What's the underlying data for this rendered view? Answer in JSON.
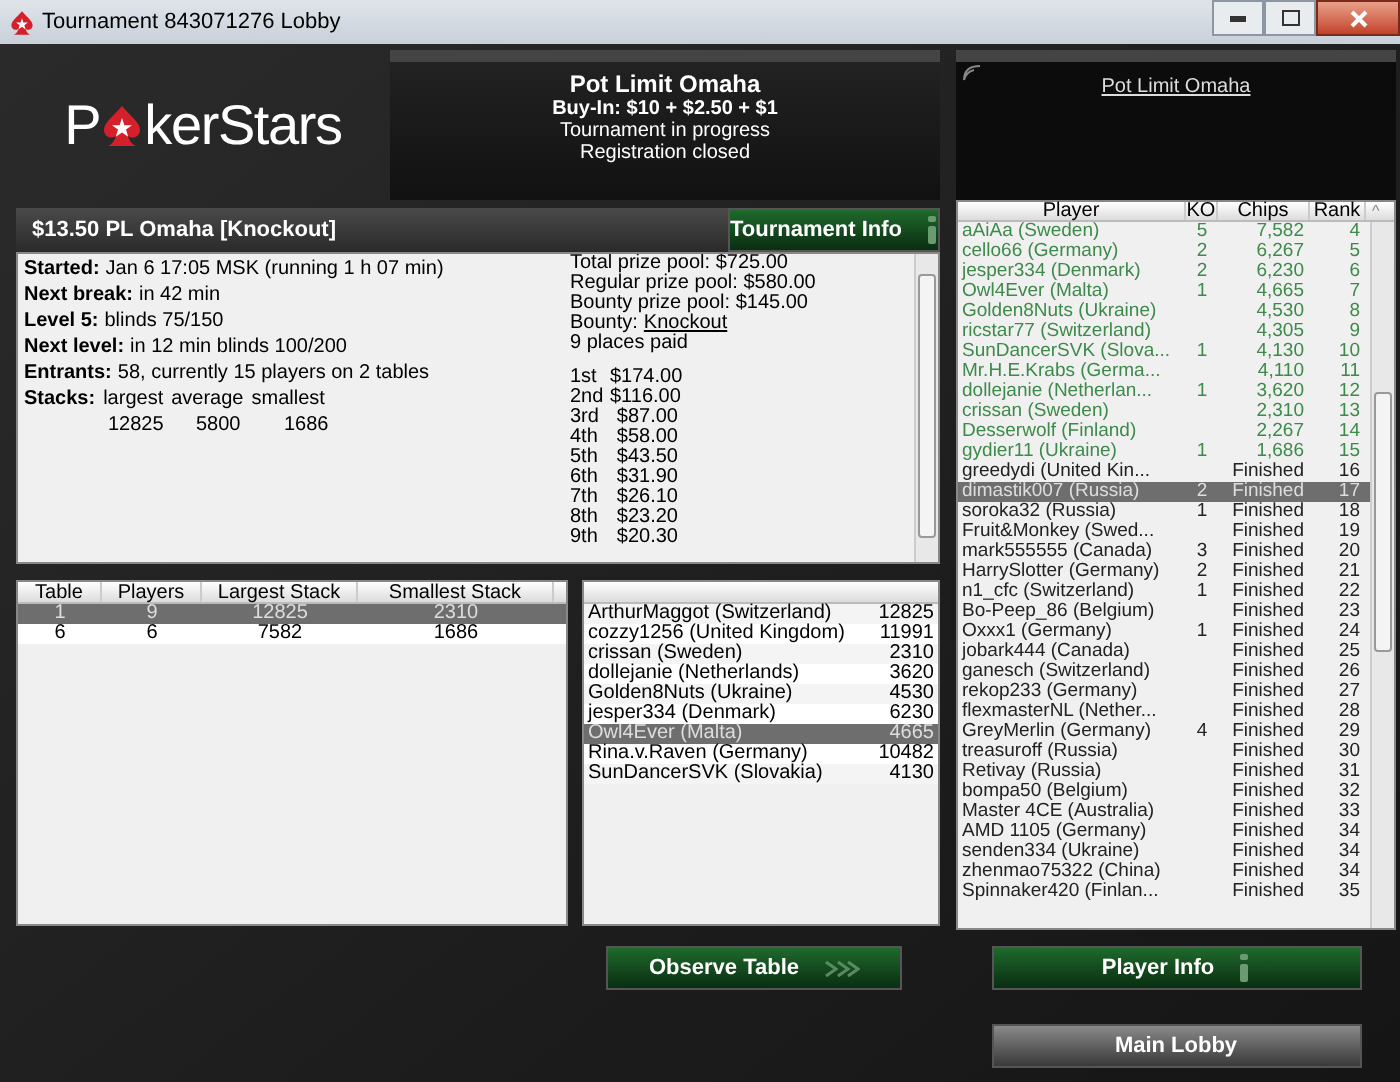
{
  "window": {
    "title": "Tournament 843071276 Lobby"
  },
  "logo": {
    "before": "P",
    "after": "kerStars"
  },
  "header": {
    "title": "Pot Limit Omaha",
    "lines": [
      "Buy-In: $10 + $2.50 + $1",
      "Tournament in progress",
      "Registration closed"
    ]
  },
  "game_link": "Pot Limit Omaha",
  "tournament": {
    "name": "$13.50 PL Omaha [Knockout]",
    "info_button": "Tournament Info"
  },
  "info": {
    "lines": [
      {
        "label": "Started:",
        "value": "Jan 6 17:05 MSK (running 1 h 07 min)"
      },
      {
        "label": "Next break:",
        "value": "in 42 min"
      },
      {
        "label": "Level 5:",
        "value": "blinds 75/150"
      },
      {
        "label": "Next level:",
        "value": "in 12 min blinds 100/200"
      },
      {
        "label": "Entrants:",
        "value": "58, currently 15 players on 2 tables"
      }
    ],
    "stacks": {
      "label": "Stacks:",
      "headers": [
        "largest",
        "average",
        "smallest"
      ],
      "values": [
        "12825",
        "5800",
        "1686"
      ]
    }
  },
  "prize": {
    "lines": [
      "Total prize pool: $725.00",
      "Regular prize pool: $580.00",
      "Bounty prize pool: $145.00"
    ],
    "bounty_label": "Bounty:",
    "bounty_link": "Knockout",
    "places_paid": "9 places paid",
    "payouts": [
      {
        "place": "1st",
        "amount": "$174.00"
      },
      {
        "place": "2nd",
        "amount": "$116.00"
      },
      {
        "place": "3rd",
        "amount": "$87.00"
      },
      {
        "place": "4th",
        "amount": "$58.00"
      },
      {
        "place": "5th",
        "amount": "$43.50"
      },
      {
        "place": "6th",
        "amount": "$31.90"
      },
      {
        "place": "7th",
        "amount": "$26.10"
      },
      {
        "place": "8th",
        "amount": "$23.20"
      },
      {
        "place": "9th",
        "amount": "$20.30"
      }
    ]
  },
  "tables": {
    "columns": [
      "Table",
      "Players",
      "Largest Stack",
      "Smallest Stack"
    ],
    "rows": [
      {
        "cells": [
          "1",
          "9",
          "12825",
          "2310"
        ],
        "selected": true
      },
      {
        "cells": [
          "6",
          "6",
          "7582",
          "1686"
        ],
        "selected": false
      }
    ]
  },
  "table_players": [
    {
      "name": "ArthurMaggot (Switzerland)",
      "chips": "12825",
      "selected": false
    },
    {
      "name": "cozzy1256 (United Kingdom)",
      "chips": "11991",
      "selected": false
    },
    {
      "name": "crissan (Sweden)",
      "chips": "2310",
      "selected": false
    },
    {
      "name": "dollejanie (Netherlands)",
      "chips": "3620",
      "selected": false
    },
    {
      "name": "Golden8Nuts (Ukraine)",
      "chips": "4530",
      "selected": false
    },
    {
      "name": "jesper334 (Denmark)",
      "chips": "6230",
      "selected": false
    },
    {
      "name": "Owl4Ever (Malta)",
      "chips": "4665",
      "selected": true
    },
    {
      "name": "Rina.v.Raven (Germany)",
      "chips": "10482",
      "selected": false
    },
    {
      "name": "SunDancerSVK (Slovakia)",
      "chips": "4130",
      "selected": false
    }
  ],
  "players": {
    "columns": [
      "Player",
      "KO",
      "Chips",
      "Rank"
    ],
    "sort_arrow": "^",
    "rows": [
      {
        "player": "aAiAa (Sweden)",
        "ko": "5",
        "chips": "7,582",
        "rank": "4",
        "in_play": true,
        "selected": false
      },
      {
        "player": "cello66 (Germany)",
        "ko": "2",
        "chips": "6,267",
        "rank": "5",
        "in_play": true,
        "selected": false
      },
      {
        "player": "jesper334 (Denmark)",
        "ko": "2",
        "chips": "6,230",
        "rank": "6",
        "in_play": true,
        "selected": false
      },
      {
        "player": "Owl4Ever (Malta)",
        "ko": "1",
        "chips": "4,665",
        "rank": "7",
        "in_play": true,
        "selected": false
      },
      {
        "player": "Golden8Nuts (Ukraine)",
        "ko": "",
        "chips": "4,530",
        "rank": "8",
        "in_play": true,
        "selected": false
      },
      {
        "player": "ricstar77 (Switzerland)",
        "ko": "",
        "chips": "4,305",
        "rank": "9",
        "in_play": true,
        "selected": false
      },
      {
        "player": "SunDancerSVK (Slova...",
        "ko": "1",
        "chips": "4,130",
        "rank": "10",
        "in_play": true,
        "selected": false
      },
      {
        "player": "Mr.H.E.Krabs (Germa...",
        "ko": "",
        "chips": "4,110",
        "rank": "11",
        "in_play": true,
        "selected": false
      },
      {
        "player": "dollejanie (Netherlan...",
        "ko": "1",
        "chips": "3,620",
        "rank": "12",
        "in_play": true,
        "selected": false
      },
      {
        "player": "crissan (Sweden)",
        "ko": "",
        "chips": "2,310",
        "rank": "13",
        "in_play": true,
        "selected": false
      },
      {
        "player": "Desserwolf (Finland)",
        "ko": "",
        "chips": "2,267",
        "rank": "14",
        "in_play": true,
        "selected": false
      },
      {
        "player": "gydier11 (Ukraine)",
        "ko": "1",
        "chips": "1,686",
        "rank": "15",
        "in_play": true,
        "selected": false
      },
      {
        "player": "greedydi (United Kin...",
        "ko": "",
        "chips": "Finished",
        "rank": "16",
        "in_play": false,
        "selected": false
      },
      {
        "player": "dimastik007 (Russia)",
        "ko": "2",
        "chips": "Finished",
        "rank": "17",
        "in_play": false,
        "selected": true
      },
      {
        "player": "soroka32 (Russia)",
        "ko": "1",
        "chips": "Finished",
        "rank": "18",
        "in_play": false,
        "selected": false
      },
      {
        "player": "Fruit&Monkey (Swed...",
        "ko": "",
        "chips": "Finished",
        "rank": "19",
        "in_play": false,
        "selected": false
      },
      {
        "player": "mark555555 (Canada)",
        "ko": "3",
        "chips": "Finished",
        "rank": "20",
        "in_play": false,
        "selected": false
      },
      {
        "player": "HarrySlotter (Germany)",
        "ko": "2",
        "chips": "Finished",
        "rank": "21",
        "in_play": false,
        "selected": false
      },
      {
        "player": "n1_cfc (Switzerland)",
        "ko": "1",
        "chips": "Finished",
        "rank": "22",
        "in_play": false,
        "selected": false
      },
      {
        "player": "Bo-Peep_86 (Belgium)",
        "ko": "",
        "chips": "Finished",
        "rank": "23",
        "in_play": false,
        "selected": false
      },
      {
        "player": "Oxxx1 (Germany)",
        "ko": "1",
        "chips": "Finished",
        "rank": "24",
        "in_play": false,
        "selected": false
      },
      {
        "player": "jobark444 (Canada)",
        "ko": "",
        "chips": "Finished",
        "rank": "25",
        "in_play": false,
        "selected": false
      },
      {
        "player": "ganesch (Switzerland)",
        "ko": "",
        "chips": "Finished",
        "rank": "26",
        "in_play": false,
        "selected": false
      },
      {
        "player": "rekop233 (Germany)",
        "ko": "",
        "chips": "Finished",
        "rank": "27",
        "in_play": false,
        "selected": false
      },
      {
        "player": "flexmasterNL (Nether...",
        "ko": "",
        "chips": "Finished",
        "rank": "28",
        "in_play": false,
        "selected": false
      },
      {
        "player": "GreyMerlin (Germany)",
        "ko": "4",
        "chips": "Finished",
        "rank": "29",
        "in_play": false,
        "selected": false
      },
      {
        "player": "treasuroff (Russia)",
        "ko": "",
        "chips": "Finished",
        "rank": "30",
        "in_play": false,
        "selected": false
      },
      {
        "player": "Retivay (Russia)",
        "ko": "",
        "chips": "Finished",
        "rank": "31",
        "in_play": false,
        "selected": false
      },
      {
        "player": "bompa50 (Belgium)",
        "ko": "",
        "chips": "Finished",
        "rank": "32",
        "in_play": false,
        "selected": false
      },
      {
        "player": "Master 4CE (Australia)",
        "ko": "",
        "chips": "Finished",
        "rank": "33",
        "in_play": false,
        "selected": false
      },
      {
        "player": "AMD 1105 (Germany)",
        "ko": "",
        "chips": "Finished",
        "rank": "34",
        "in_play": false,
        "selected": false
      },
      {
        "player": "senden334 (Ukraine)",
        "ko": "",
        "chips": "Finished",
        "rank": "34",
        "in_play": false,
        "selected": false
      },
      {
        "player": "zhenmao75322 (China)",
        "ko": "",
        "chips": "Finished",
        "rank": "34",
        "in_play": false,
        "selected": false
      },
      {
        "player": "Spinnaker420 (Finlan...",
        "ko": "",
        "chips": "Finished",
        "rank": "35",
        "in_play": false,
        "selected": false
      }
    ]
  },
  "buttons": {
    "observe": "Observe Table",
    "player_info": "Player Info",
    "main_lobby": "Main Lobby"
  }
}
